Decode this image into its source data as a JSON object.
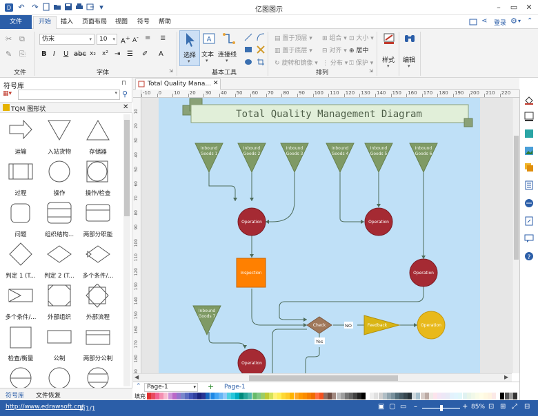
{
  "app": {
    "title": "亿图图示",
    "login": "登录"
  },
  "menu": {
    "file": "文件",
    "tabs": [
      "开始",
      "插入",
      "页面布局",
      "视图",
      "符号",
      "帮助"
    ]
  },
  "ribbon": {
    "font_name": "仿宋",
    "font_size": "10",
    "groups": {
      "file": "文件",
      "font": "字体",
      "basic_tools": "基本工具",
      "arrange": "排列"
    },
    "tools": {
      "select": "选择",
      "text": "文本",
      "connector": "连接线",
      "style": "样式",
      "edit": "编辑"
    },
    "arrange_items": [
      "置于顶层",
      "组合",
      "大小",
      "置于底层",
      "对齐",
      "居中",
      "旋转和镜像",
      "分布",
      "保护"
    ]
  },
  "library": {
    "title": "符号库",
    "search_placeholder": "",
    "category": "TQM 图形状",
    "shapes": [
      {
        "label": "运输",
        "icon": "arrow-shape"
      },
      {
        "label": "入站货物",
        "icon": "triangle-down-shape"
      },
      {
        "label": "存储器",
        "icon": "triangle-up-shape"
      },
      {
        "label": "过程",
        "icon": "process-shape"
      },
      {
        "label": "操作",
        "icon": "circle-shape"
      },
      {
        "label": "操作/检查",
        "icon": "circle-square-shape"
      },
      {
        "label": "问题",
        "icon": "rounded-square-shape"
      },
      {
        "label": "组织结构...",
        "icon": "org-shape"
      },
      {
        "label": "两部分职能",
        "icon": "two-part-shape"
      },
      {
        "label": "判定 1 (T...",
        "icon": "diamond-shape"
      },
      {
        "label": "判定 2 (T...",
        "icon": "diamond-wide-shape"
      },
      {
        "label": "多个条件/...",
        "icon": "multi-diamond-shape"
      },
      {
        "label": "多个条件/...",
        "icon": "multi-diamond2-shape"
      },
      {
        "label": "外部组织",
        "icon": "octagon-square-shape"
      },
      {
        "label": "外部流程",
        "icon": "diamond-square-shape"
      },
      {
        "label": "检查/衡量",
        "icon": "square-shape"
      },
      {
        "label": "公制",
        "icon": "rect-shape"
      },
      {
        "label": "两部分公制",
        "icon": "rect-two-shape"
      },
      {
        "label": "",
        "icon": "circle-line-shape"
      },
      {
        "label": "",
        "icon": "circle-shape"
      },
      {
        "label": "",
        "icon": "circle-lines-shape"
      }
    ],
    "bottom_tabs": [
      "符号库",
      "文件恢复"
    ]
  },
  "document": {
    "tab": "Total Quality Mana..."
  },
  "ruler": {
    "h": [
      "-10",
      "0",
      "10",
      "20",
      "30",
      "40",
      "50",
      "60",
      "70",
      "80",
      "90",
      "100",
      "110",
      "120",
      "130",
      "140",
      "150",
      "160",
      "170",
      "180",
      "190",
      "200",
      "210",
      "220"
    ],
    "v": [
      "10",
      "20",
      "30",
      "40",
      "50",
      "60",
      "70",
      "80",
      "90",
      "100",
      "110",
      "120",
      "130",
      "140",
      "150",
      "160",
      "170",
      "180",
      "190"
    ]
  },
  "diagram": {
    "title": "Total Quality Management Diagram",
    "inbound": [
      {
        "line1": "Inbound",
        "line2": "Goods 1"
      },
      {
        "line1": "Inbound",
        "line2": "Goods 2"
      },
      {
        "line1": "Inbound",
        "line2": "Goods 3"
      },
      {
        "line1": "Inbound",
        "line2": "Goods 4"
      },
      {
        "line1": "Inbound",
        "line2": "Goods 5"
      },
      {
        "line1": "Inbound",
        "line2": "Goods 6"
      },
      {
        "line1": "Inbound",
        "line2": "Goods 7"
      }
    ],
    "operation": "Operation",
    "inspection": "Inspection",
    "check": "Check",
    "feedback": "Feedback",
    "no": "NO",
    "yes": "Yes",
    "colors": {
      "inbound": "#7f9a65",
      "operation": "#a52a33",
      "inspection": "#ff8000",
      "check": "#a0785a",
      "feedback": "#d9b514",
      "page": "#bfe0f7"
    }
  },
  "pages": {
    "current": "Page-1",
    "tab": "Page-1",
    "fill_label": "填充"
  },
  "status": {
    "url": "http://www.edrawsoft.cn/",
    "page_info": "页1/1",
    "zoom": "85%"
  }
}
